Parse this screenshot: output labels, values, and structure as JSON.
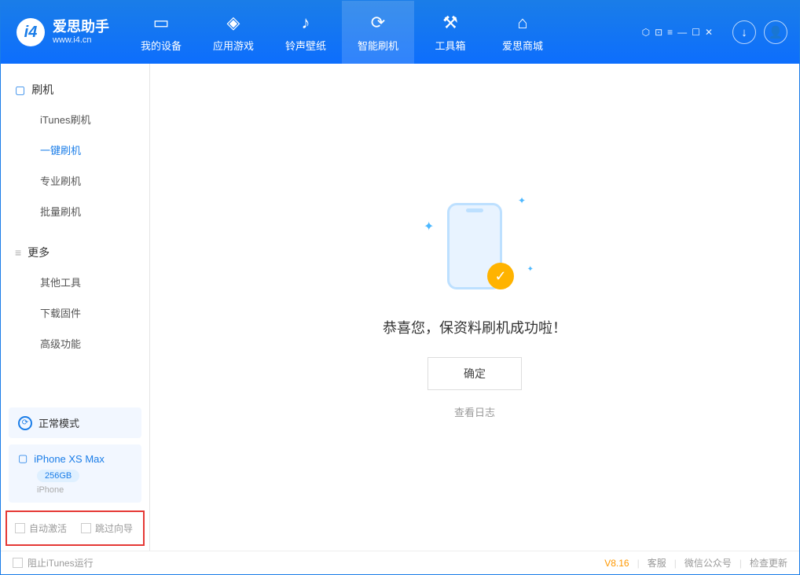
{
  "header": {
    "logo_title": "爱思助手",
    "logo_sub": "www.i4.cn",
    "tabs": [
      {
        "label": "我的设备"
      },
      {
        "label": "应用游戏"
      },
      {
        "label": "铃声壁纸"
      },
      {
        "label": "智能刷机"
      },
      {
        "label": "工具箱"
      },
      {
        "label": "爱思商城"
      }
    ]
  },
  "sidebar": {
    "section1_title": "刷机",
    "items1": [
      {
        "label": "iTunes刷机"
      },
      {
        "label": "一键刷机"
      },
      {
        "label": "专业刷机"
      },
      {
        "label": "批量刷机"
      }
    ],
    "section2_title": "更多",
    "items2": [
      {
        "label": "其他工具"
      },
      {
        "label": "下载固件"
      },
      {
        "label": "高级功能"
      }
    ],
    "mode_label": "正常模式",
    "device_name": "iPhone XS Max",
    "device_storage": "256GB",
    "device_type": "iPhone",
    "opt_auto_activate": "自动激活",
    "opt_skip_wizard": "跳过向导"
  },
  "main": {
    "success_text": "恭喜您，保资料刷机成功啦！",
    "ok_button": "确定",
    "view_log": "查看日志"
  },
  "statusbar": {
    "block_itunes": "阻止iTunes运行",
    "version": "V8.16",
    "link_cs": "客服",
    "link_wechat": "微信公众号",
    "link_update": "检查更新"
  }
}
